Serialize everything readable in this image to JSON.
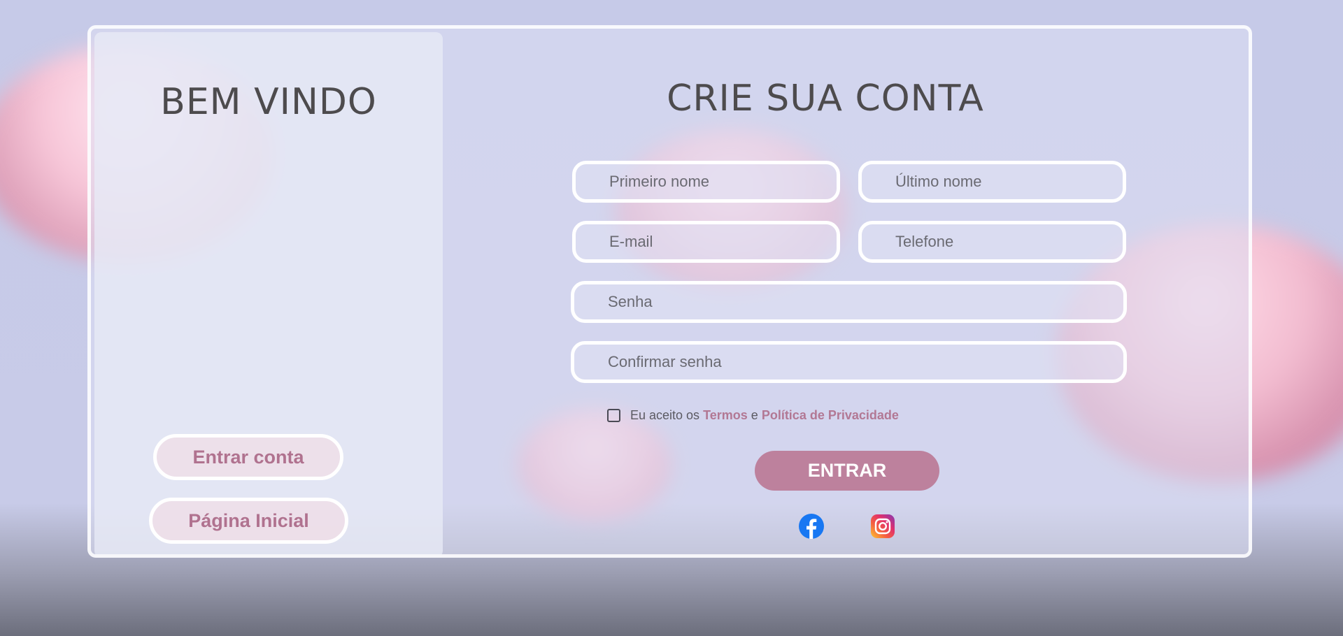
{
  "left": {
    "title": "BEM VINDO",
    "login_button": "Entrar conta",
    "home_button": "Página Inicial"
  },
  "form": {
    "title": "CRIE SUA CONTA",
    "first_name_placeholder": "Primeiro nome",
    "last_name_placeholder": "Último nome",
    "email_placeholder": "E-mail",
    "phone_placeholder": "Telefone",
    "password_placeholder": "Senha",
    "confirm_password_placeholder": "Confirmar senha",
    "terms_prefix": "Eu aceito os",
    "terms_link": "Termos",
    "terms_joiner": "e",
    "privacy_link": "Política de Privacidade",
    "terms_checked": false,
    "submit_label": "ENTRAR"
  },
  "social": {
    "icons": [
      "facebook-icon",
      "instagram-icon"
    ]
  },
  "colors": {
    "accent": "#bd819d",
    "link": "#b27894",
    "title_text": "#4d4b4d"
  }
}
